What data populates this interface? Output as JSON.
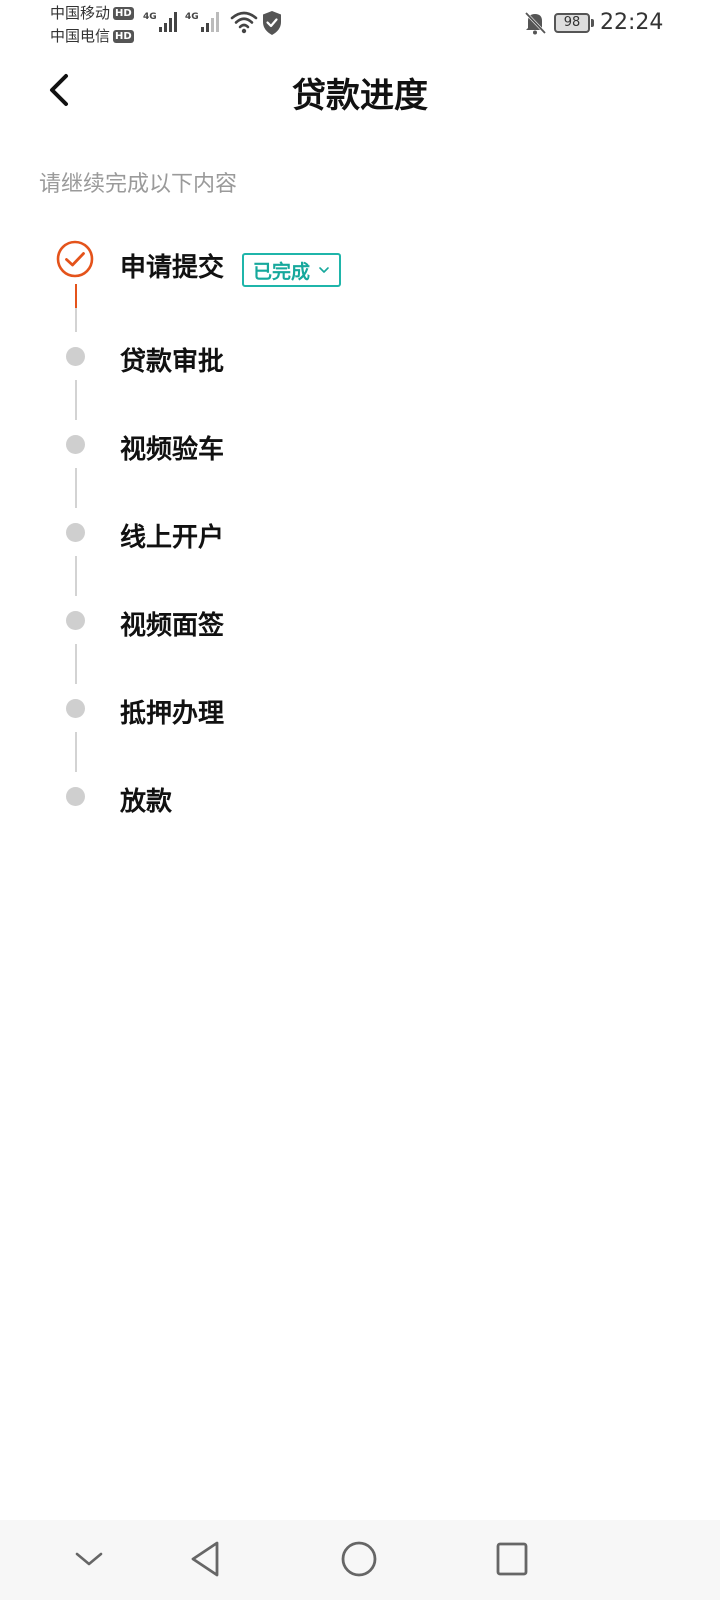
{
  "status_bar": {
    "carrier_1": "中国移动",
    "carrier_2": "中国电信",
    "hd_label": "HD",
    "network_tag": "4G",
    "battery_level": "98",
    "time": "22:24"
  },
  "header": {
    "title": "贷款进度",
    "back_icon": "back-arrow-icon"
  },
  "subtitle": "请继续完成以下内容",
  "steps": [
    {
      "label": "申请提交",
      "status": "completed",
      "badge": "已完成"
    },
    {
      "label": "贷款审批",
      "status": "pending"
    },
    {
      "label": "视频验车",
      "status": "pending"
    },
    {
      "label": "线上开户",
      "status": "pending"
    },
    {
      "label": "视频面签",
      "status": "pending"
    },
    {
      "label": "抵押办理",
      "status": "pending"
    },
    {
      "label": "放款",
      "status": "pending"
    }
  ],
  "colors": {
    "accent": "#e4531b",
    "done_badge": "#16a89c",
    "pending_dot": "#cfcfcf"
  },
  "nav_bar": {
    "icons": [
      "chevron-down-icon",
      "back-triangle-icon",
      "home-circle-icon",
      "recents-square-icon"
    ]
  }
}
